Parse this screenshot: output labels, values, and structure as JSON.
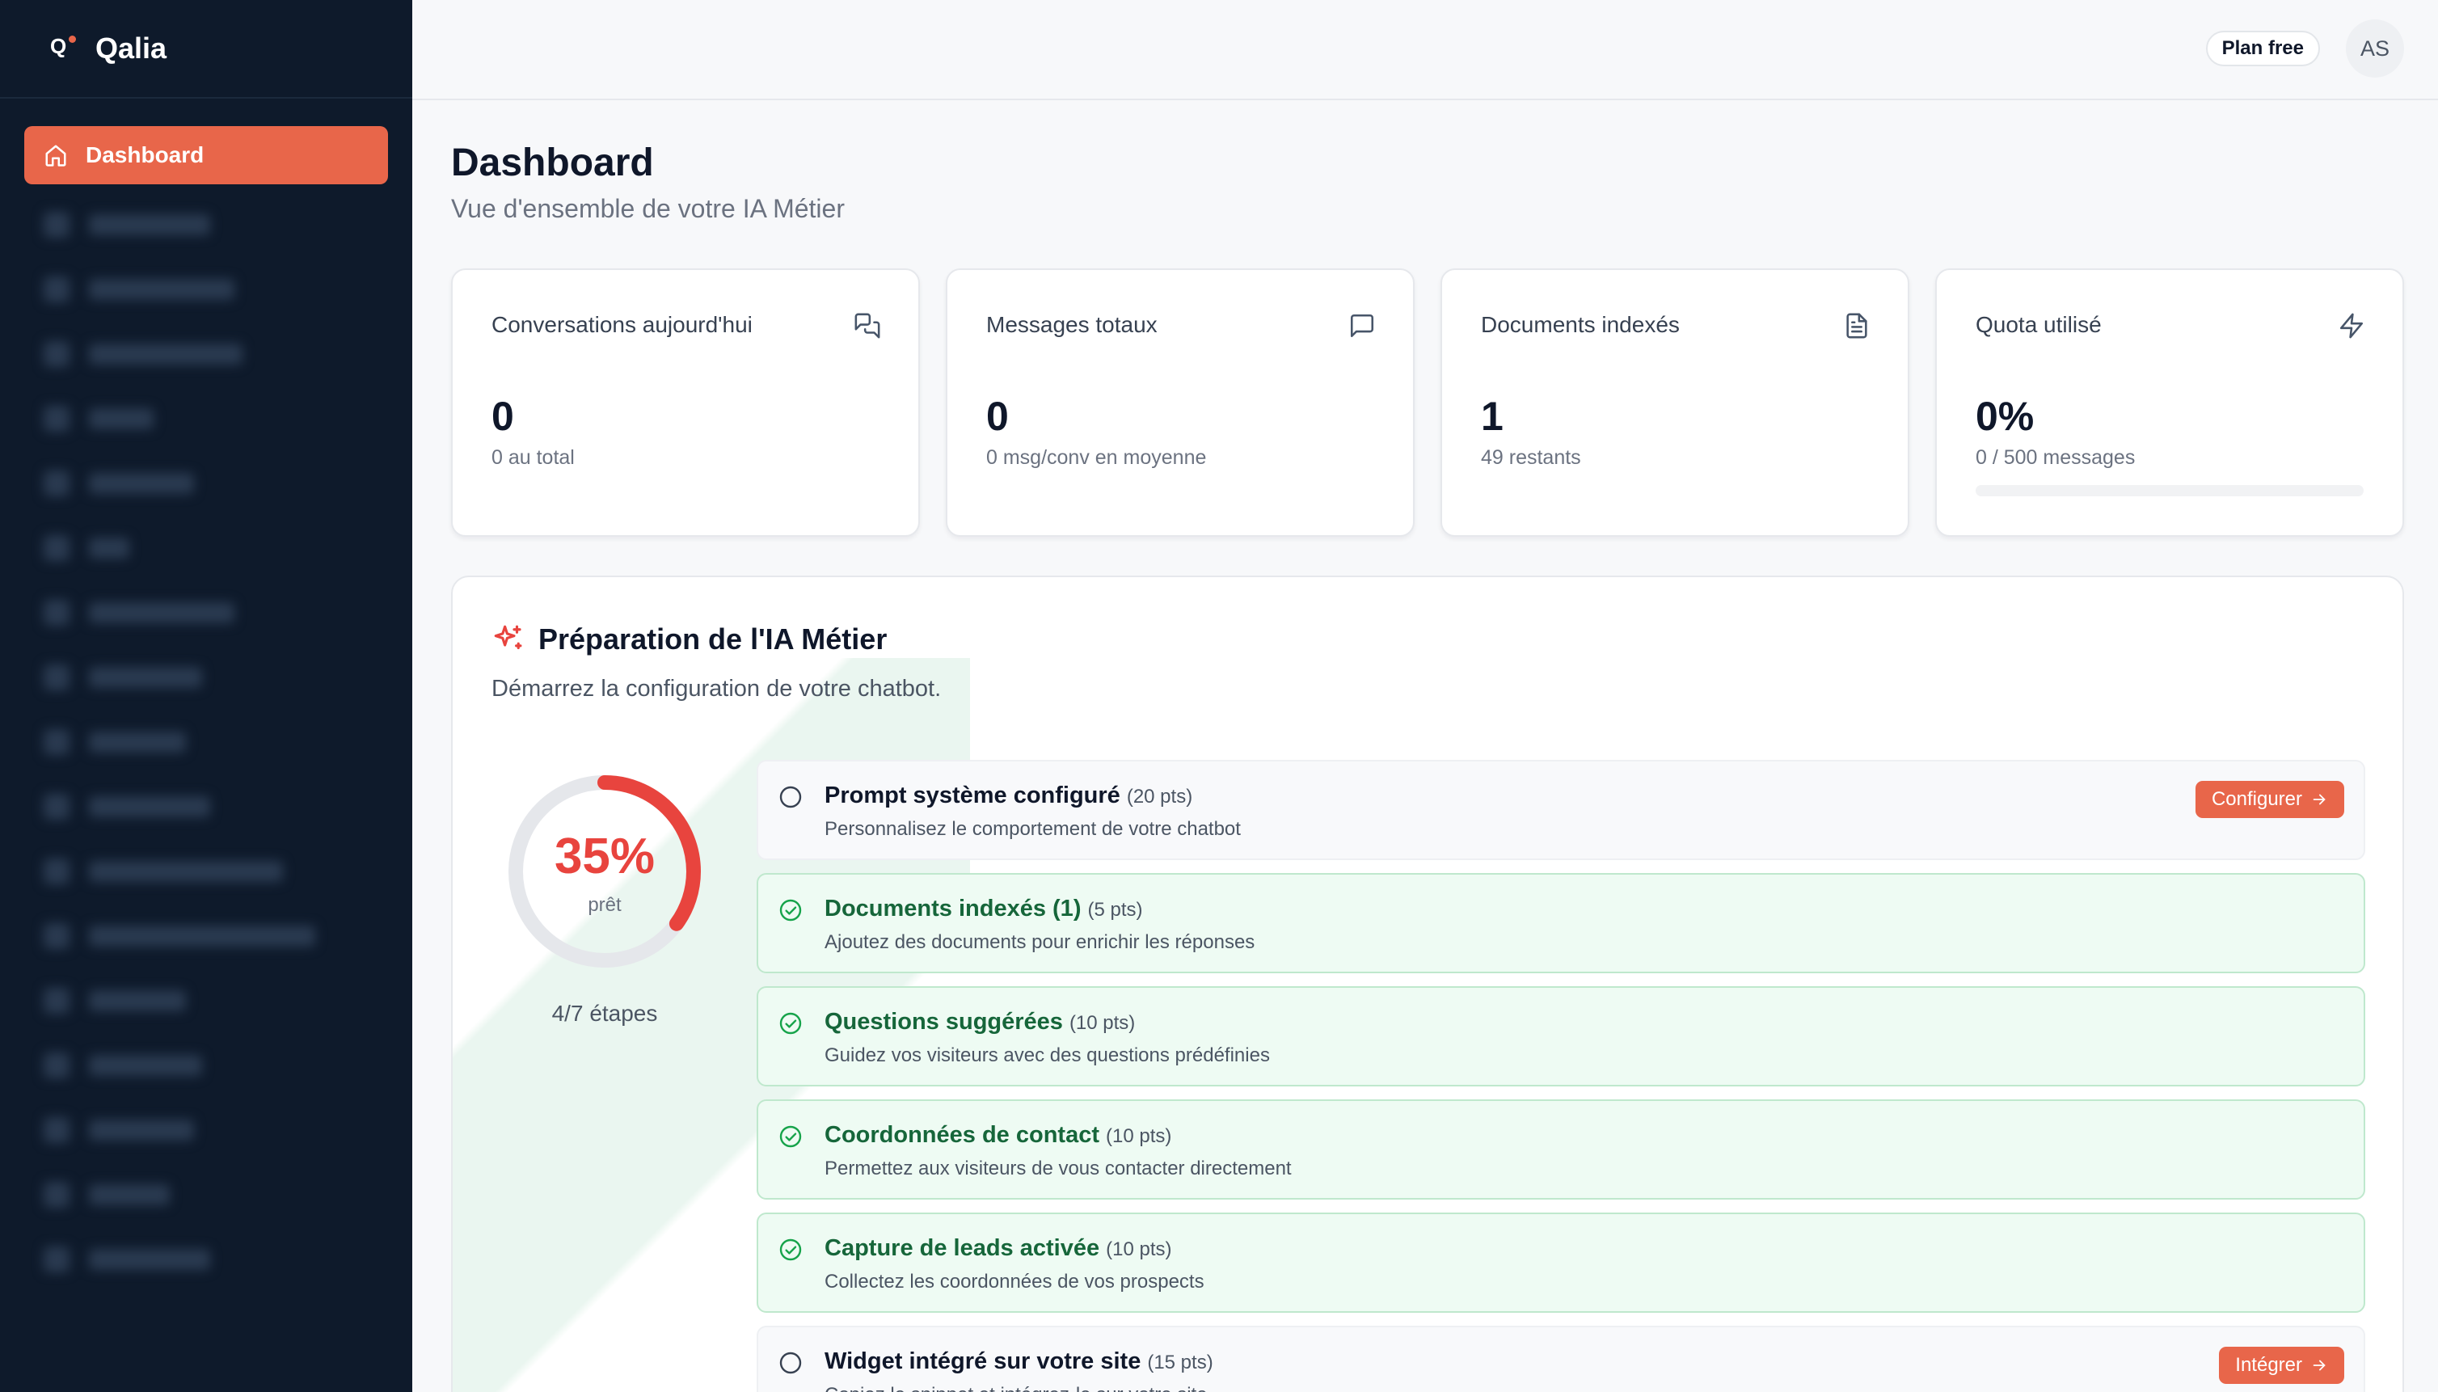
{
  "brand": {
    "name": "Qalia",
    "logo_letter": "Q"
  },
  "sidebar": {
    "active_item": "Dashboard"
  },
  "header": {
    "plan": "Plan free",
    "avatar": "AS"
  },
  "page": {
    "title": "Dashboard",
    "subtitle": "Vue d'ensemble de votre IA Métier"
  },
  "stats": [
    {
      "title": "Conversations aujourd'hui",
      "value": "0",
      "sub": "0 au total",
      "icon": "chat-bubbles-icon"
    },
    {
      "title": "Messages totaux",
      "value": "0",
      "sub": "0 msg/conv en moyenne",
      "icon": "message-square-icon"
    },
    {
      "title": "Documents indexés",
      "value": "1",
      "sub": "49 restants",
      "icon": "document-icon"
    },
    {
      "title": "Quota utilisé",
      "value": "0%",
      "sub": "0 / 500 messages",
      "icon": "lightning-icon",
      "progress_percent": 0
    }
  ],
  "prep": {
    "title": "Préparation de l'IA Métier",
    "description": "Démarrez la configuration de votre chatbot.",
    "percent_label": "35%",
    "percent": 35,
    "ready_label": "prêt",
    "steps_label": "4/7 étapes",
    "tasks": [
      {
        "name": "Prompt système configuré",
        "pts": "(20 pts)",
        "desc": "Personnalisez le comportement de votre chatbot",
        "done": false,
        "action": "Configurer"
      },
      {
        "name": "Documents indexés (1)",
        "pts": "(5 pts)",
        "desc": "Ajoutez des documents pour enrichir les réponses",
        "done": true
      },
      {
        "name": "Questions suggérées",
        "pts": "(10 pts)",
        "desc": "Guidez vos visiteurs avec des questions prédéfinies",
        "done": true
      },
      {
        "name": "Coordonnées de contact",
        "pts": "(10 pts)",
        "desc": "Permettez aux visiteurs de vous contacter directement",
        "done": true
      },
      {
        "name": "Capture de leads activée",
        "pts": "(10 pts)",
        "desc": "Collectez les coordonnées de vos prospects",
        "done": true
      },
      {
        "name": "Widget intégré sur votre site",
        "pts": "(15 pts)",
        "desc": "Copiez le snippet et intégrez-le sur votre site",
        "done": false,
        "action": "Intégrer"
      }
    ]
  },
  "colors": {
    "accent": "#e8664a",
    "sidebar": "#0e1a2b",
    "success": "#16a34a",
    "ring": "#e8443e"
  }
}
